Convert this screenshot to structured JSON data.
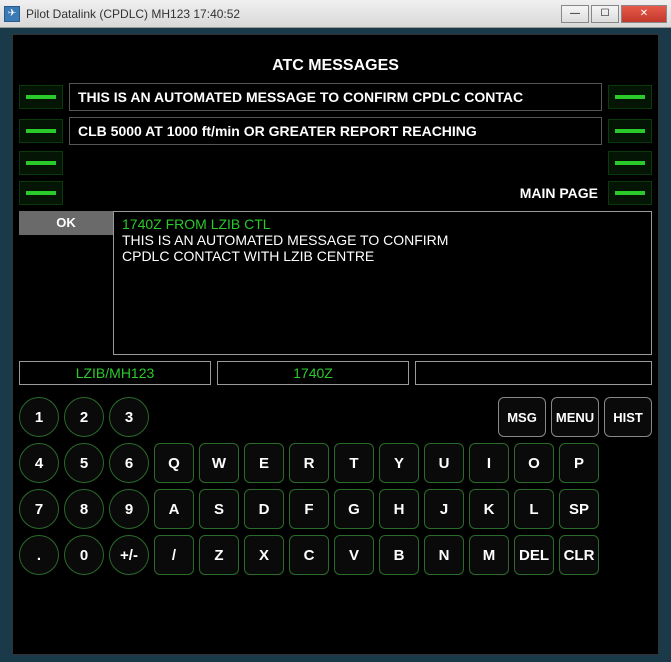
{
  "window": {
    "title": "Pilot Datalink (CPDLC) MH123    17:40:52"
  },
  "header": {
    "title": "ATC MESSAGES"
  },
  "messages": [
    "THIS IS AN AUTOMATED MESSAGE TO CONFIRM CPDLC CONTAC",
    "CLB 5000 AT 1000 ft/min OR GREATER REPORT REACHING"
  ],
  "main_page_label": "MAIN PAGE",
  "ok_label": "OK",
  "display": {
    "header": "1740Z FROM LZIB CTL",
    "line1": "THIS IS AN AUTOMATED MESSAGE TO CONFIRM",
    "line2": "CPDLC CONTACT WITH LZIB CENTRE"
  },
  "status": {
    "left": "LZIB/MH123",
    "mid": "1740Z",
    "right": ""
  },
  "keys": {
    "n1": "1",
    "n2": "2",
    "n3": "3",
    "n4": "4",
    "n5": "5",
    "n6": "6",
    "n7": "7",
    "n8": "8",
    "n9": "9",
    "n0": "0",
    "dot": ".",
    "pm": "+/-",
    "q": "Q",
    "w": "W",
    "e": "E",
    "r": "R",
    "t": "T",
    "y": "Y",
    "u": "U",
    "i": "I",
    "o": "O",
    "p": "P",
    "a": "A",
    "s": "S",
    "d": "D",
    "f": "F",
    "g": "G",
    "h": "H",
    "j": "J",
    "k": "K",
    "l": "L",
    "sp": "SP",
    "sl": "/",
    "z": "Z",
    "x": "X",
    "c": "C",
    "v": "V",
    "b": "B",
    "n": "N",
    "m": "M",
    "del": "DEL",
    "clr": "CLR",
    "msg": "MSG",
    "menu": "MENU",
    "hist": "HIST"
  }
}
